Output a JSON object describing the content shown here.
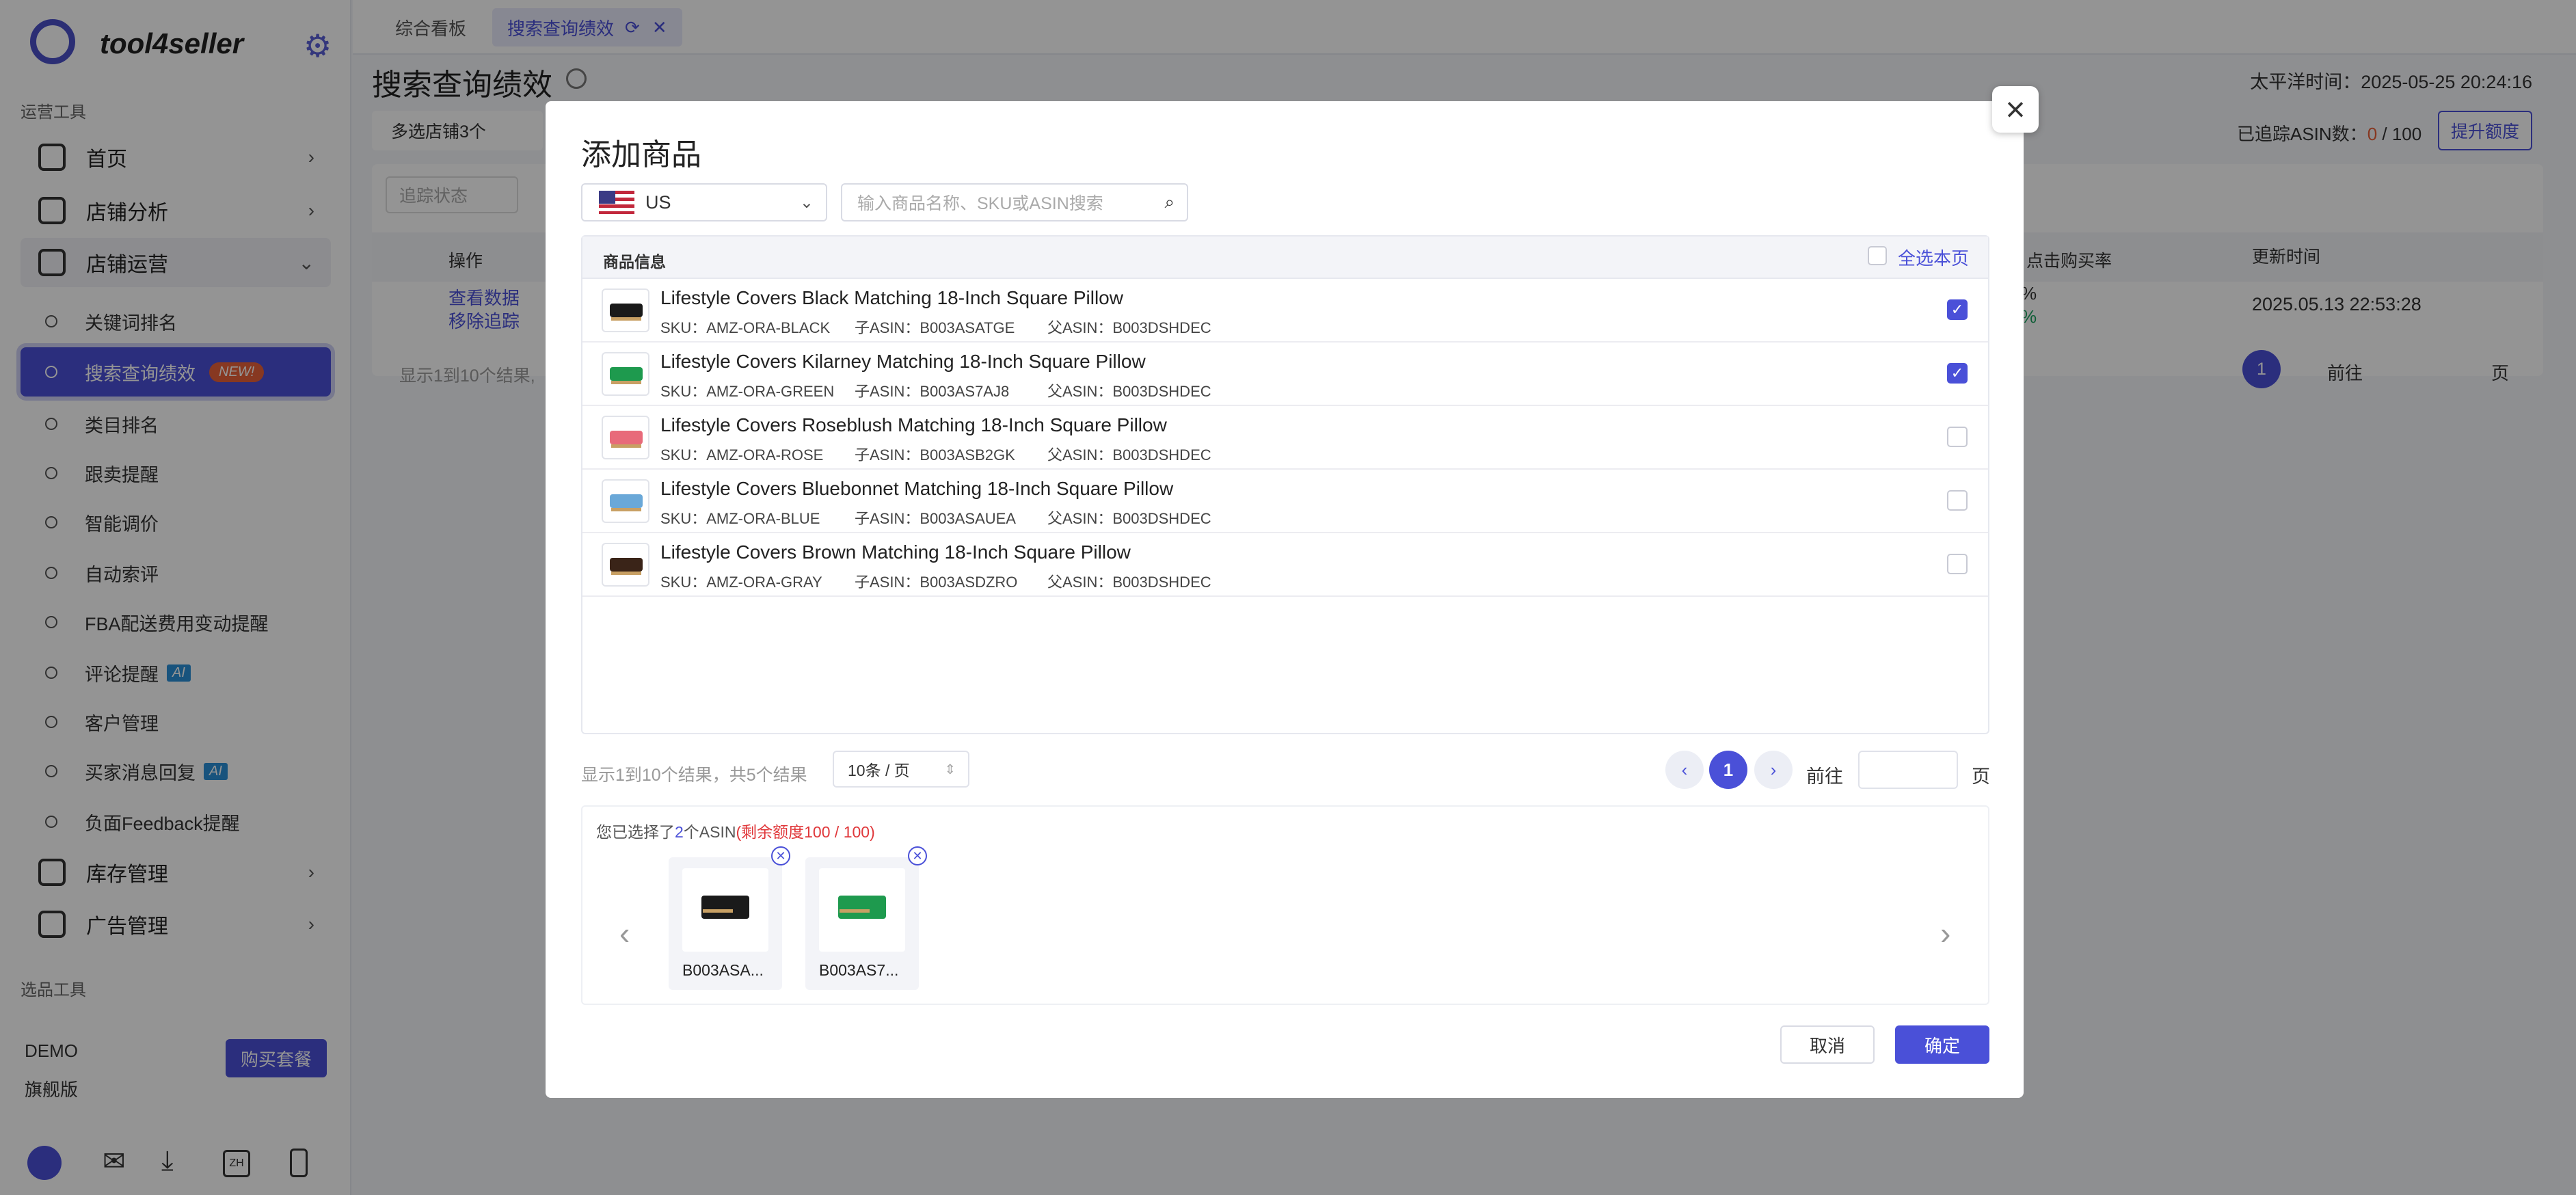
{
  "app": {
    "logo_text": "tool4seller"
  },
  "sidebar": {
    "section_ops": "运营工具",
    "section_select": "选品工具",
    "main_items": [
      {
        "label": "首页",
        "icon": "home-icon"
      },
      {
        "label": "店铺分析",
        "icon": "chart-icon"
      },
      {
        "label": "店铺运营",
        "icon": "store-icon"
      },
      {
        "label": "库存管理",
        "icon": "inventory-icon"
      },
      {
        "label": "广告管理",
        "icon": "ad-icon"
      }
    ],
    "sub_items": [
      {
        "label": "关键词排名"
      },
      {
        "label": "搜索查询绩效",
        "badge": "NEW!"
      },
      {
        "label": "类目排名"
      },
      {
        "label": "跟卖提醒"
      },
      {
        "label": "智能调价"
      },
      {
        "label": "自动索评"
      },
      {
        "label": "FBA配送费用变动提醒"
      },
      {
        "label": "评论提醒",
        "badge": "AI"
      },
      {
        "label": "客户管理"
      },
      {
        "label": "买家消息回复",
        "badge": "AI"
      },
      {
        "label": "负面Feedback提醒"
      }
    ],
    "plan_name": "DEMO",
    "plan_level": "旗舰版",
    "buy_label": "购买套餐",
    "lang": "ZH"
  },
  "tabs": [
    {
      "label": "综合看板"
    },
    {
      "label": "搜索查询绩效"
    }
  ],
  "page": {
    "title": "搜索查询绩效",
    "timezone_label": "太平洋时间：2025-05-25 20:24:16",
    "store_select": "多选店铺3个",
    "tracked_label": "已追踪ASIN数：",
    "tracked_used": "0",
    "tracked_total": "/ 100",
    "upgrade_label": "提升额度",
    "filter_status": "追踪状态",
    "col_action": "操作",
    "col_ctr": "点击购买率",
    "col_update": "更新时间",
    "action_view": "查看数据",
    "action_remove": "移除追踪",
    "ctr_value_1": "%",
    "ctr_value_2": "%",
    "update_time": "2025.05.13 22:53:28",
    "bg_page_info": "显示1到10个结果,",
    "bg_page_num": "1",
    "bg_goto": "前往",
    "bg_page_unit": "页"
  },
  "modal": {
    "title": "添加商品",
    "marketplace": "US",
    "search_placeholder": "输入商品名称、SKU或ASIN搜索",
    "col_product": "商品信息",
    "select_all": "全选本页",
    "products": [
      {
        "name": "Lifestyle Covers Black Matching 18-Inch Square Pillow",
        "sku": "SKU：AMZ-ORA-BLACK",
        "child": "子ASIN：B003ASATGE",
        "parent": "父ASIN：B003DSHDEC",
        "checked": true,
        "color": "#1a1a1a"
      },
      {
        "name": "Lifestyle Covers Kilarney Matching 18-Inch Square Pillow",
        "sku": "SKU：AMZ-ORA-GREEN",
        "child": "子ASIN：B003AS7AJ8",
        "parent": "父ASIN：B003DSHDEC",
        "checked": true,
        "color": "#1e9a4e"
      },
      {
        "name": "Lifestyle Covers Roseblush Matching 18-Inch Square Pillow",
        "sku": "SKU：AMZ-ORA-ROSE",
        "child": "子ASIN：B003ASB2GK",
        "parent": "父ASIN：B003DSHDEC",
        "checked": false,
        "color": "#e86a7a"
      },
      {
        "name": "Lifestyle Covers Bluebonnet Matching 18-Inch Square Pillow",
        "sku": "SKU：AMZ-ORA-BLUE",
        "child": "子ASIN：B003ASAUEA",
        "parent": "父ASIN：B003DSHDEC",
        "checked": false,
        "color": "#6aa8d8"
      },
      {
        "name": "Lifestyle Covers Brown Matching 18-Inch Square Pillow",
        "sku": "SKU：AMZ-ORA-GRAY",
        "child": "子ASIN：B003ASDZRO",
        "parent": "父ASIN：B003DSHDEC",
        "checked": false,
        "color": "#3a2418"
      }
    ],
    "page_info": "显示1到10个结果，共5个结果",
    "per_page": "10条 / 页",
    "current_page": "1",
    "goto_label": "前往",
    "page_unit": "页",
    "selected_prefix": "您已选择了",
    "selected_count": "2",
    "selected_suffix": "个ASIN",
    "quota_text": "(剩余额度100 / 100)",
    "selected_items": [
      {
        "label": "B003ASA...",
        "color": "#1a1a1a"
      },
      {
        "label": "B003AS7...",
        "color": "#1e9a4e"
      }
    ],
    "cancel_label": "取消",
    "ok_label": "确定"
  },
  "colors": {
    "accent": "#4a50d8",
    "danger": "#e8613a",
    "quota": "#e0383b"
  }
}
